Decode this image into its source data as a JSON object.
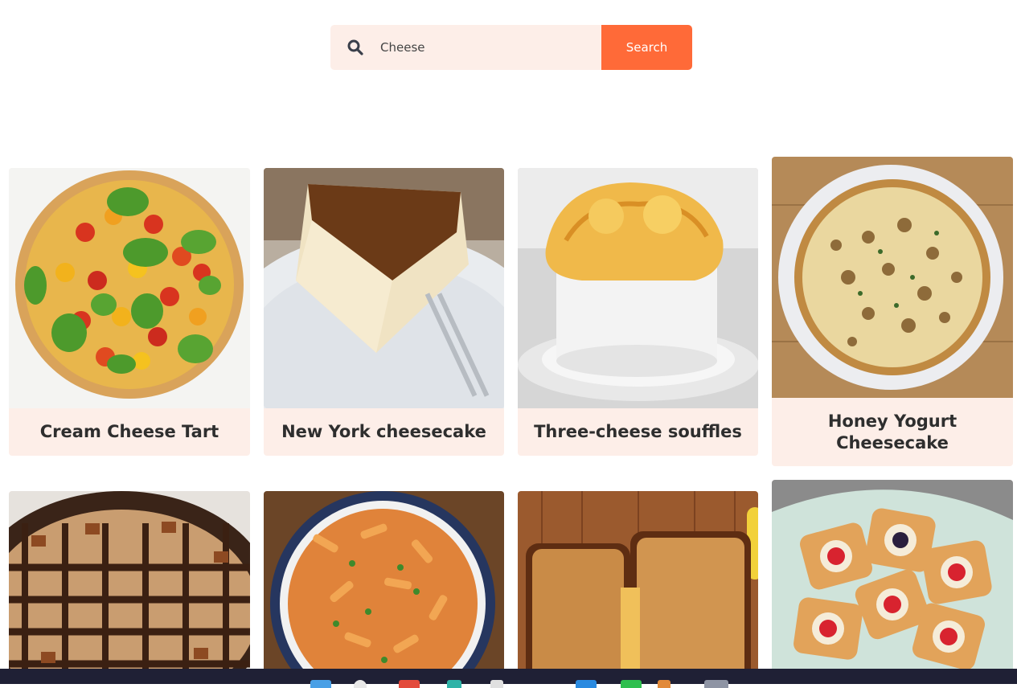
{
  "search": {
    "value": "Cheese",
    "button_label": "Search",
    "icon": "search-icon"
  },
  "recipes": [
    {
      "title": "Cream Cheese Tart"
    },
    {
      "title": "New York cheesecake"
    },
    {
      "title": "Three-cheese souffles"
    },
    {
      "title": "Honey Yogurt Cheesecake"
    },
    {
      "title": ""
    },
    {
      "title": ""
    },
    {
      "title": ""
    },
    {
      "title": ""
    }
  ],
  "colors": {
    "accent": "#ff6a38",
    "card_bg": "#fdeee8",
    "taskbar": "#1f2035"
  },
  "taskbar_icons": [
    "windows-icon",
    "search-icon",
    "chrome-icon",
    "edge-icon",
    "files-icon",
    "app-icon",
    "whatsapp-icon",
    "app-icon",
    "app-icon"
  ]
}
